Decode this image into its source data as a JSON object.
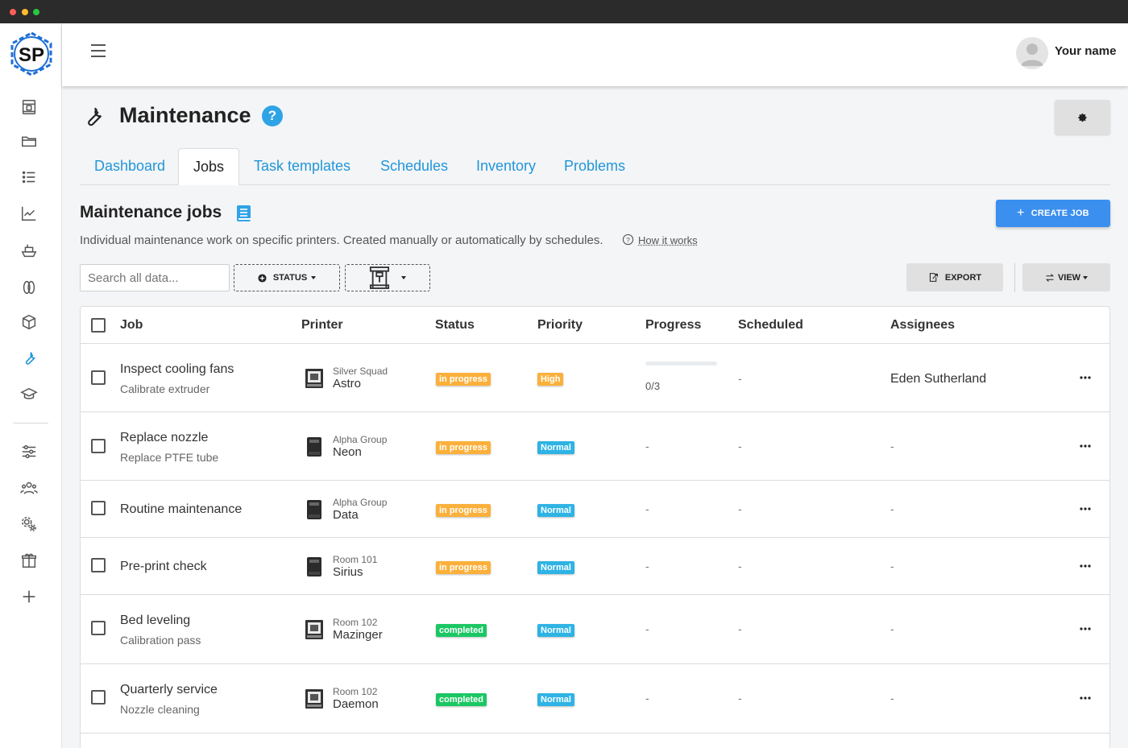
{
  "brand": {
    "logo_text": "SP",
    "accent": "#2196d9",
    "logo_color": "#1f6fd6"
  },
  "sidebar": {
    "items": [
      {
        "icon": "printer-icon"
      },
      {
        "icon": "folder-icon"
      },
      {
        "icon": "list-icon"
      },
      {
        "icon": "chart-icon"
      },
      {
        "icon": "ship-icon"
      },
      {
        "icon": "filament-icon"
      },
      {
        "icon": "box-icon"
      },
      {
        "icon": "wrench-icon",
        "active": true
      },
      {
        "icon": "graduation-cap-icon"
      },
      {
        "icon": "sliders-icon"
      },
      {
        "icon": "users-icon"
      },
      {
        "icon": "gears-icon"
      },
      {
        "icon": "gift-icon"
      },
      {
        "icon": "plus-icon"
      }
    ]
  },
  "header": {
    "username": "Your name"
  },
  "page": {
    "title": "Maintenance",
    "help": "?"
  },
  "tabs": [
    {
      "label": "Dashboard"
    },
    {
      "label": "Jobs",
      "active": true
    },
    {
      "label": "Task templates"
    },
    {
      "label": "Schedules"
    },
    {
      "label": "Inventory"
    },
    {
      "label": "Problems"
    }
  ],
  "section": {
    "title": "Maintenance jobs",
    "description": "Individual maintenance work on specific printers. Created manually or automatically by schedules.",
    "how_it_works": "How it works",
    "create_label": "CREATE JOB"
  },
  "toolbar": {
    "search_placeholder": "Search all data...",
    "status_filter": "STATUS",
    "export_label": "EXPORT",
    "view_label": "VIEW"
  },
  "table": {
    "columns": {
      "job": "Job",
      "printer": "Printer",
      "status": "Status",
      "priority": "Priority",
      "progress": "Progress",
      "scheduled": "Scheduled",
      "assignees": "Assignees"
    },
    "rows": [
      {
        "name": "Inspect cooling fans",
        "sub": "Calibrate extruder",
        "printer_group": "Silver Squad",
        "printer_name": "Astro",
        "status": "in progress",
        "status_color": "#fbb03b",
        "priority": "High",
        "priority_color": "#fbb03b",
        "progress": "0/3",
        "progress_fraction": 0,
        "scheduled": "-",
        "assignees": "Eden Sutherland"
      },
      {
        "name": "Replace nozzle",
        "sub": "Replace PTFE tube",
        "printer_group": "Alpha Group",
        "printer_name": "Neon",
        "status": "in progress",
        "status_color": "#fbb03b",
        "priority": "Normal",
        "priority_color": "#2eb3e4",
        "progress": "-",
        "scheduled": "-",
        "assignees": "-"
      },
      {
        "name": "Routine maintenance",
        "sub": "",
        "printer_group": "Alpha Group",
        "printer_name": "Data",
        "status": "in progress",
        "status_color": "#fbb03b",
        "priority": "Normal",
        "priority_color": "#2eb3e4",
        "progress": "-",
        "scheduled": "-",
        "assignees": "-"
      },
      {
        "name": "Pre-print check",
        "sub": "",
        "printer_group": "Room 101",
        "printer_name": "Sirius",
        "status": "in progress",
        "status_color": "#fbb03b",
        "priority": "Normal",
        "priority_color": "#2eb3e4",
        "progress": "-",
        "scheduled": "-",
        "assignees": "-"
      },
      {
        "name": "Bed leveling",
        "sub": "Calibration pass",
        "printer_group": "Room 102",
        "printer_name": "Mazinger",
        "status": "completed",
        "status_color": "#1bc763",
        "priority": "Normal",
        "priority_color": "#2eb3e4",
        "progress": "-",
        "scheduled": "-",
        "assignees": "-"
      },
      {
        "name": "Quarterly service",
        "sub": "Nozzle cleaning",
        "printer_group": "Room 102",
        "printer_name": "Daemon",
        "status": "completed",
        "status_color": "#1bc763",
        "priority": "Normal",
        "priority_color": "#2eb3e4",
        "progress": "-",
        "scheduled": "-",
        "assignees": "-"
      }
    ]
  }
}
